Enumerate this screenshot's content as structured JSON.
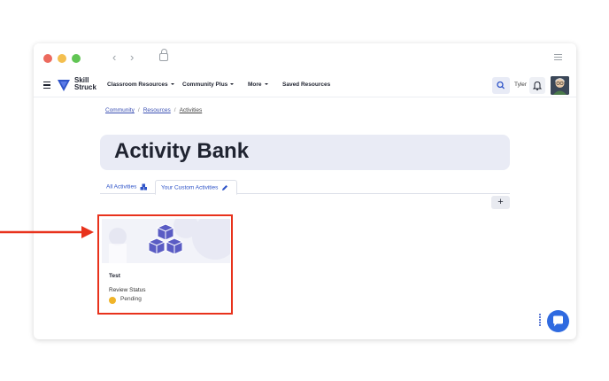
{
  "browser": {
    "back_icon": "chevron-left-icon",
    "forward_icon": "chevron-right-icon",
    "lock_icon": "lock-icon",
    "settings_icon": "sliders-icon"
  },
  "navbar": {
    "logo_line1": "Skill",
    "logo_line2": "Struck",
    "menu": [
      {
        "label": "Classroom Resources",
        "has_caret": true
      },
      {
        "label": "Community Plus",
        "has_caret": true
      },
      {
        "label": "More",
        "has_caret": true
      },
      {
        "label": "Saved Resources",
        "has_caret": false
      }
    ],
    "user_name": "Tyler"
  },
  "breadcrumb": {
    "items": [
      "Community",
      "Resources",
      "Activities"
    ],
    "separator": "/"
  },
  "hero": {
    "title": "Activity Bank"
  },
  "tabs": [
    {
      "label": "All Activities",
      "active": false
    },
    {
      "label": "Your Custom Activities",
      "active": true
    }
  ],
  "add_button": {
    "label": "+"
  },
  "card": {
    "title": "Test",
    "review_label": "Review Status",
    "status": "Pending",
    "status_color": "#f0b429"
  },
  "colors": {
    "accent": "#2f54c8",
    "highlight": "#e8321c",
    "hero_bg": "#e9ebf5",
    "cube": "#5a5cc4"
  }
}
